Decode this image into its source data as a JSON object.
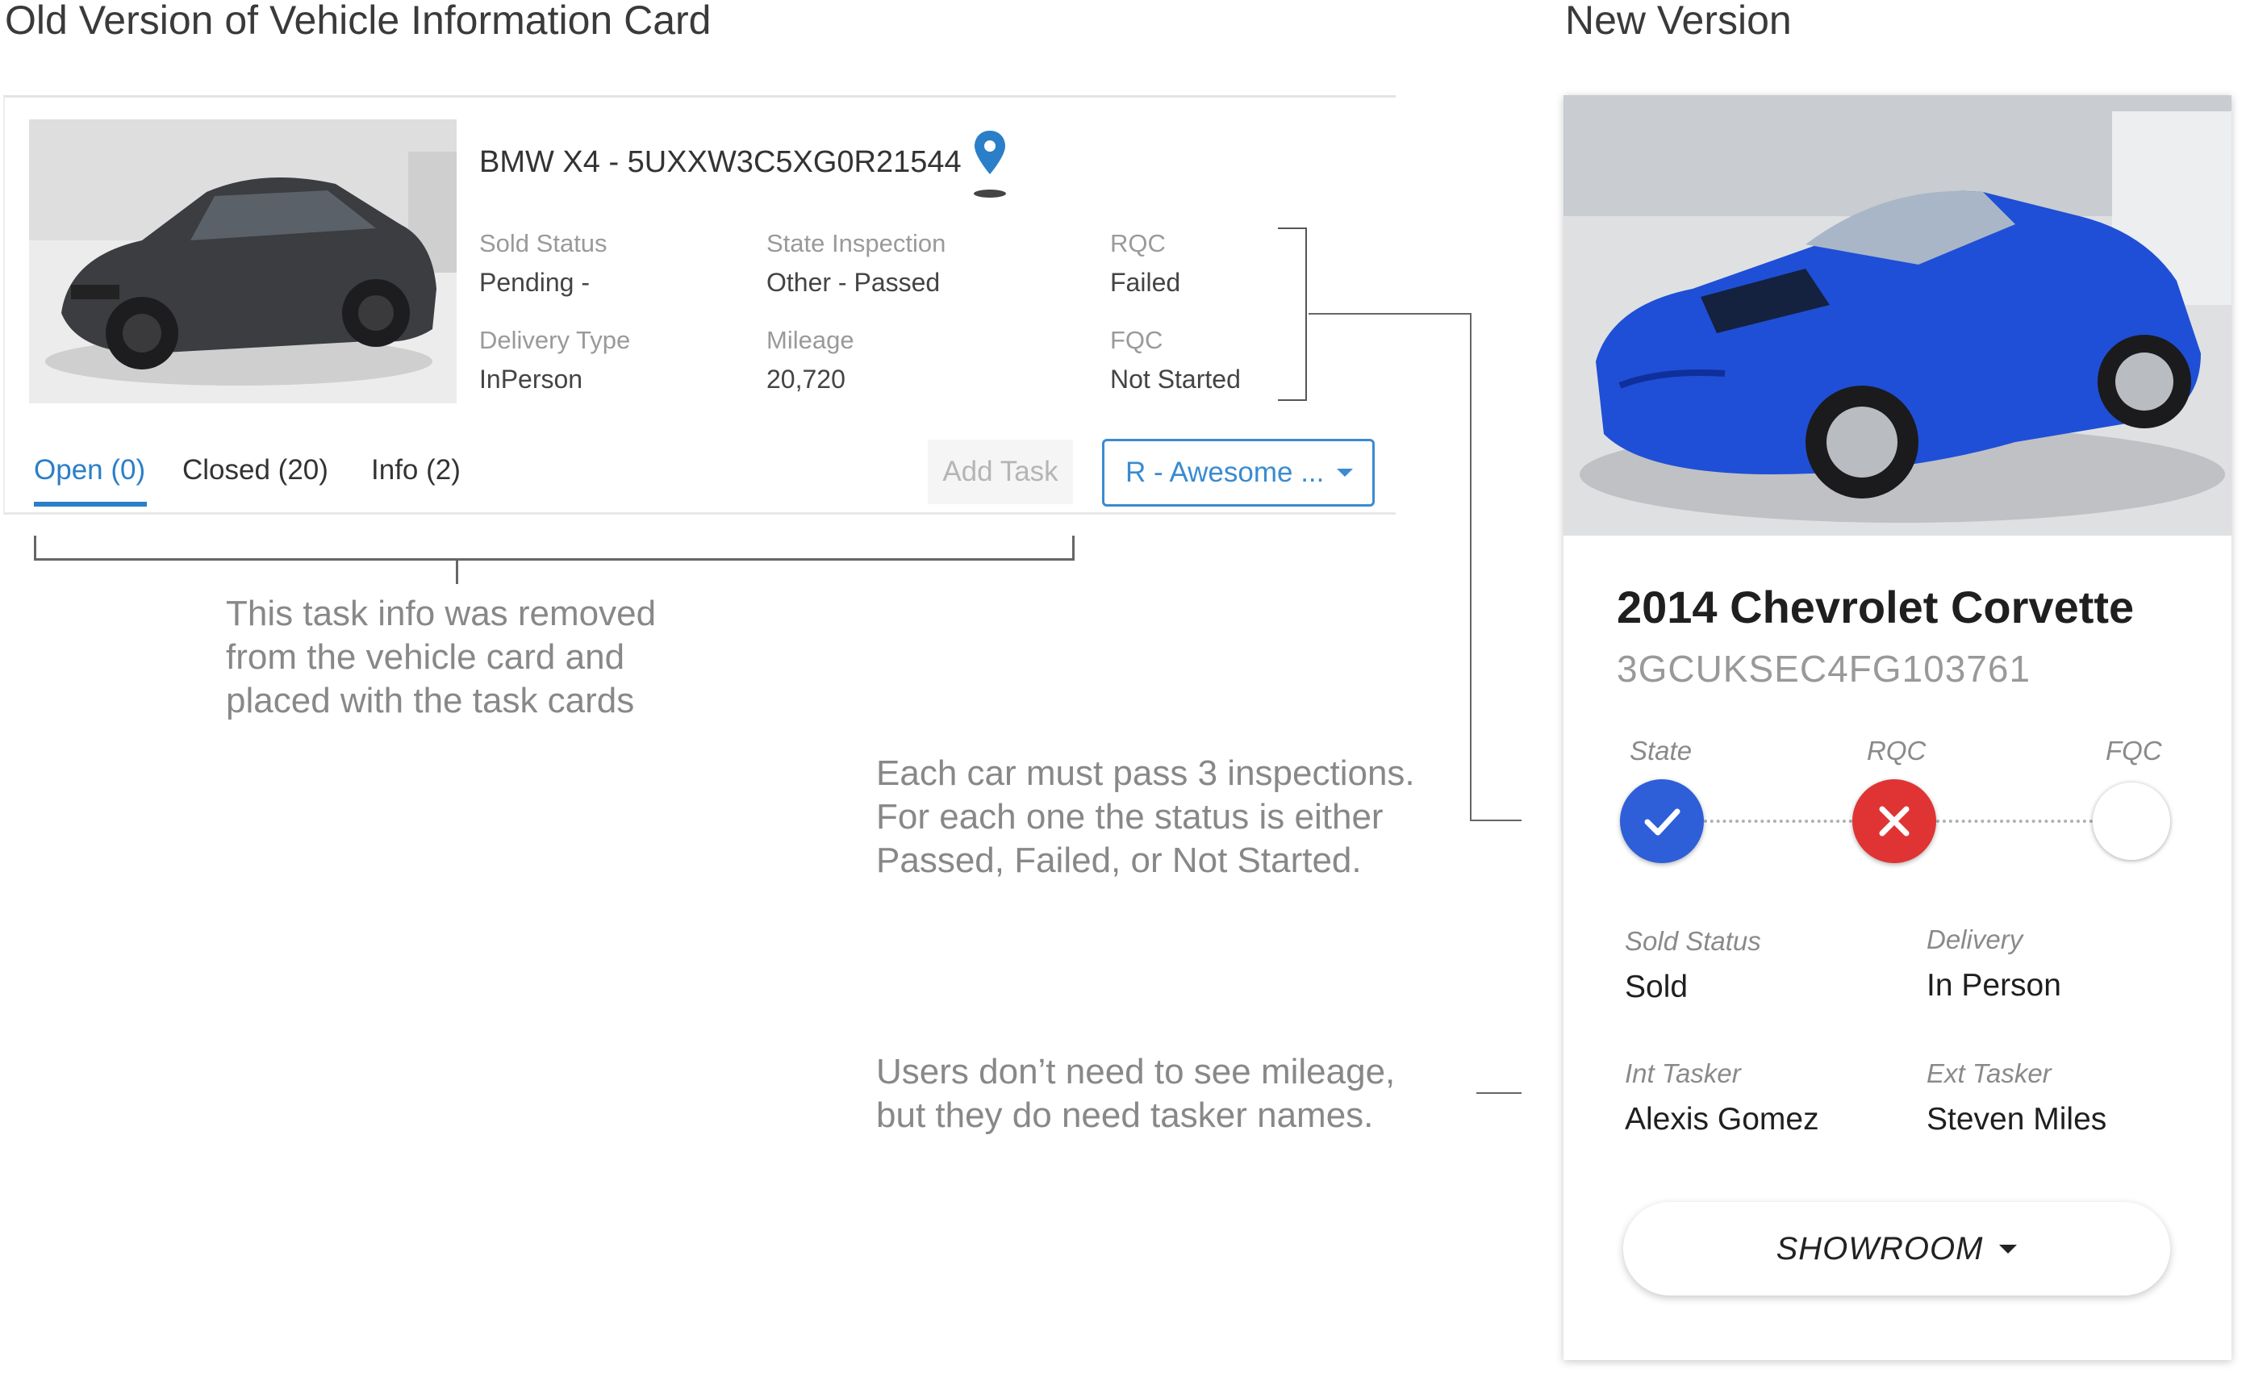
{
  "headings": {
    "old": "Old Version of Vehicle Information Card",
    "new": "New Version"
  },
  "old_card": {
    "title": "BMW X4 - 5UXXW3C5XG0R21544",
    "fields": [
      {
        "label": "Sold Status",
        "value": "Pending -"
      },
      {
        "label": "State Inspection",
        "value": "Other - Passed"
      },
      {
        "label": "RQC",
        "value": "Failed"
      },
      {
        "label": "Delivery Type",
        "value": "InPerson"
      },
      {
        "label": "Mileage",
        "value": "20,720"
      },
      {
        "label": "FQC",
        "value": "Not Started"
      }
    ],
    "tabs": [
      {
        "label": "Open (0)",
        "active": true
      },
      {
        "label": "Closed (20)",
        "active": false
      },
      {
        "label": "Info (2)",
        "active": false
      }
    ],
    "add_task_label": "Add Task",
    "select_value": "R - Awesome ...",
    "accent_color": "#2a7fc8"
  },
  "annotations": {
    "task_info": [
      "This task info was removed",
      "from the vehicle card and",
      "placed with the task cards"
    ],
    "inspections": [
      "Each car must pass 3 inspections.",
      "For each one the status is either",
      "Passed, Failed, or Not Started."
    ],
    "taskers": [
      "Users don’t need to see mileage,",
      "but they do need tasker names."
    ]
  },
  "new_card": {
    "title": "2014 Chevrolet Corvette",
    "vin": "3GCUKSEC4FG103761",
    "inspections": [
      {
        "label": "State",
        "status": "passed",
        "color": "#2e5fd9"
      },
      {
        "label": "RQC",
        "status": "failed",
        "color": "#e03434"
      },
      {
        "label": "FQC",
        "status": "not-started",
        "color": "#ffffff"
      }
    ],
    "fields": [
      {
        "label": "Sold Status",
        "value": "Sold"
      },
      {
        "label": "Delivery",
        "value": "In Person"
      },
      {
        "label": "Int Tasker",
        "value": "Alexis Gomez"
      },
      {
        "label": "Ext Tasker",
        "value": "Steven Miles"
      }
    ],
    "button_label": "SHOWROOM"
  }
}
